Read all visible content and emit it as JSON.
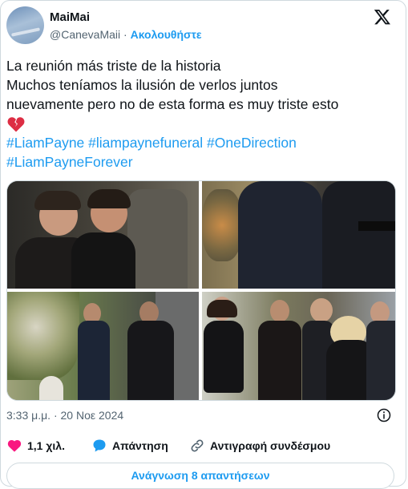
{
  "author": {
    "name": "MaiMai",
    "handle": "@CanevaMaii",
    "follow_label": "Ακολουθήστε"
  },
  "tweet": {
    "lines": [
      "La reunión más triste de la historia",
      "Muchos teníamos la ilusión de verlos juntos",
      "nuevamente pero no de esta forma es muy triste esto"
    ],
    "emoji": "broken-heart-icon",
    "hashtags_line1": "#LiamPayne #liampaynefuneral #OneDirection",
    "hashtags_line2": "#LiamPayneForever"
  },
  "meta": {
    "time": "3:33 μ.μ.",
    "separator": "·",
    "date": "20 Νοε 2024"
  },
  "actions": {
    "likes": "1,1 χιλ.",
    "reply": "Απάντηση",
    "copy_link": "Αντιγραφή συνδέσμου"
  },
  "read_replies": "Ανάγνωση 8 απαντήσεων",
  "colors": {
    "accent": "#1d9bf0",
    "like": "#f91880",
    "text": "#0f1419",
    "muted": "#536471",
    "border": "#cfd9de"
  }
}
